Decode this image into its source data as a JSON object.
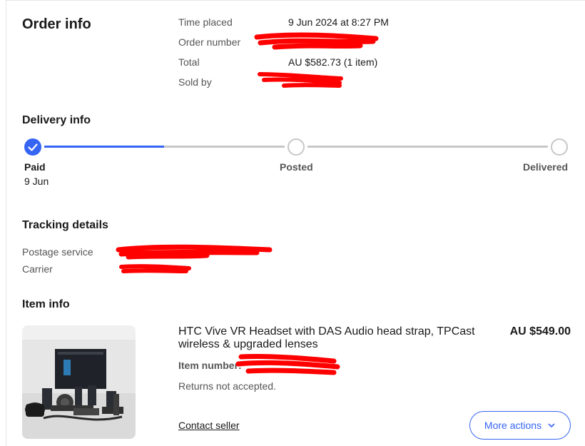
{
  "order_info": {
    "heading": "Order info",
    "time_placed_label": "Time placed",
    "time_placed_value": "9 Jun 2024 at 8:27 PM",
    "order_number_label": "Order number",
    "total_label": "Total",
    "total_value": "AU $582.73 (1 item)",
    "sold_by_label": "Sold by"
  },
  "delivery": {
    "heading": "Delivery info",
    "progress_fraction": 0.3,
    "steps": [
      {
        "label": "Paid",
        "date": "9 Jun",
        "done": true
      },
      {
        "label": "Posted",
        "done": false
      },
      {
        "label": "Delivered",
        "done": false
      }
    ]
  },
  "tracking": {
    "heading": "Tracking details",
    "postage_service_label": "Postage service",
    "carrier_label": "Carrier"
  },
  "item": {
    "heading": "Item info",
    "title": "HTC Vive VR Headset with DAS Audio head strap, TPCast wireless & upgraded lenses",
    "price": "AU $549.00",
    "item_number_label": "Item number:",
    "returns": "Returns not accepted.",
    "contact_seller": "Contact seller",
    "more_actions": "More actions"
  },
  "colors": {
    "accent": "#3665f3",
    "redaction": "#ff0000",
    "track": "#c7c7c7"
  },
  "icons": [
    "check-icon",
    "chevron-down-icon"
  ]
}
